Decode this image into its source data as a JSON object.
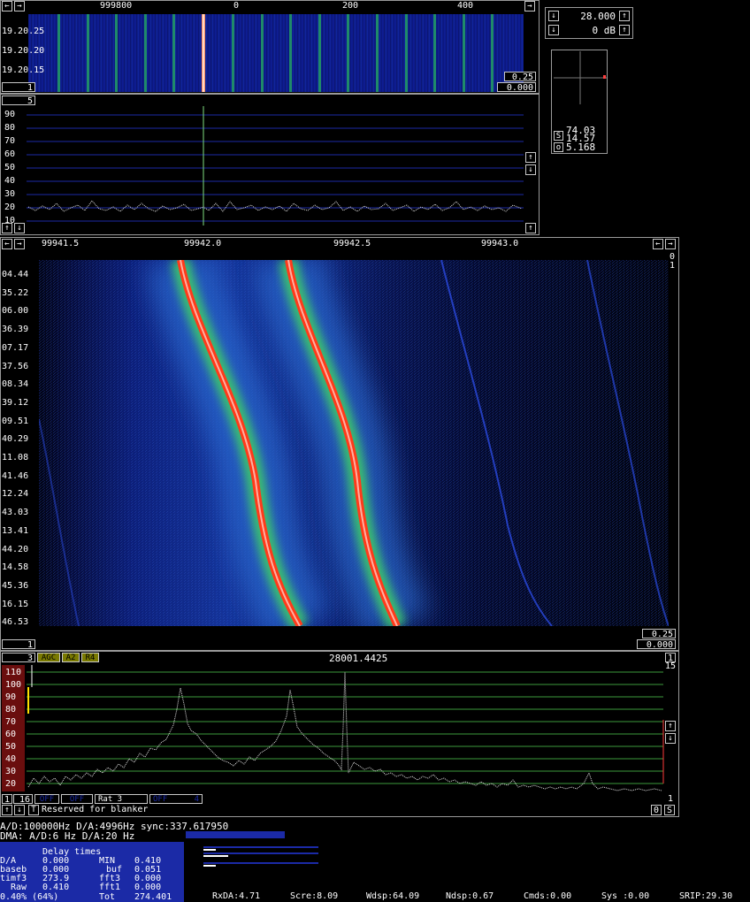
{
  "top_waterfall": {
    "freq_ticks": [
      "999800",
      "0",
      "200",
      "400"
    ],
    "time_labels": [
      "19.20.25",
      "19.20.20",
      "19.20.15"
    ],
    "gain_box": "0.25",
    "offset_box": "0.000",
    "left_box": "1"
  },
  "top_spectrum": {
    "left_box": "5",
    "y_ticks": [
      "90",
      "80",
      "70",
      "60",
      "50",
      "40",
      "30",
      "20",
      "10"
    ]
  },
  "controls": {
    "freq_value": "28.000",
    "gain_value": "0 dB"
  },
  "scope": {
    "s_label": "S",
    "o_label": "o",
    "value1": "74.03",
    "value2": "14.57",
    "value3": "5.168"
  },
  "main_waterfall": {
    "freq_ticks": [
      "99941.5",
      "99942.0",
      "99942.5",
      "99943.0"
    ],
    "time_labels": [
      "04.44",
      "35.22",
      "06.00",
      "36.39",
      "07.17",
      "37.56",
      "08.34",
      "39.12",
      "09.51",
      "40.29",
      "11.08",
      "41.46",
      "12.24",
      "43.03",
      "13.41",
      "44.20",
      "14.58",
      "45.36",
      "16.15",
      "46.53"
    ],
    "right_top": "0",
    "right_top2": "1",
    "gain_box": "0.25",
    "offset_box": "0.000",
    "left_box": "1",
    "right_box": "1"
  },
  "main_spectrum": {
    "avg_box": "3",
    "agc": "AGC",
    "a2": "A2",
    "r4": "R4",
    "center_freq": "28001.4425",
    "right_box": "1",
    "right_val": "15",
    "y_ticks": [
      "110",
      "100",
      "90",
      "80",
      "70",
      "60",
      "50",
      "40",
      "30",
      "20"
    ],
    "bottom_left": "1",
    "bottom_right": "1"
  },
  "bottom_bar": {
    "b1": "1",
    "b16": "16",
    "off1": "OFF",
    "off2": "OFF",
    "rat": "Rat   3",
    "off3": "OFF",
    "off3val": "4",
    "t_label": "T",
    "reserved": "Reserved for blanker",
    "right0": "0",
    "rightS": "S"
  },
  "status": {
    "line1": "A/D:100000Hz  D/A:4996Hz  sync:337.617950",
    "line2": "DMA:  A/D:6 Hz   D/A:20 Hz",
    "delay_title": "Delay times",
    "rows": [
      {
        "a": "D/A",
        "b": "0.000",
        "c": "MIN",
        "d": "0.410"
      },
      {
        "a": "baseb",
        "b": "0.000",
        "c": "buf",
        "d": "0.051"
      },
      {
        "a": "timf3",
        "b": "273.9",
        "c": "fft3",
        "d": "0.000"
      },
      {
        "a": "Raw",
        "b": "0.410",
        "c": "fft1",
        "d": "0.000"
      }
    ],
    "load": "0.40%  (64%)",
    "tot_label": "Tot",
    "tot_val": "274.401",
    "rxda": "RxDA:4.71",
    "scre": "Scre:8.09",
    "wdsp": "Wdsp:64.09",
    "ndsp": "Ndsp:0.67",
    "cmds": "Cmds:0.00",
    "sys": "Sys :0.00",
    "srip": "SRIP:29.30"
  }
}
